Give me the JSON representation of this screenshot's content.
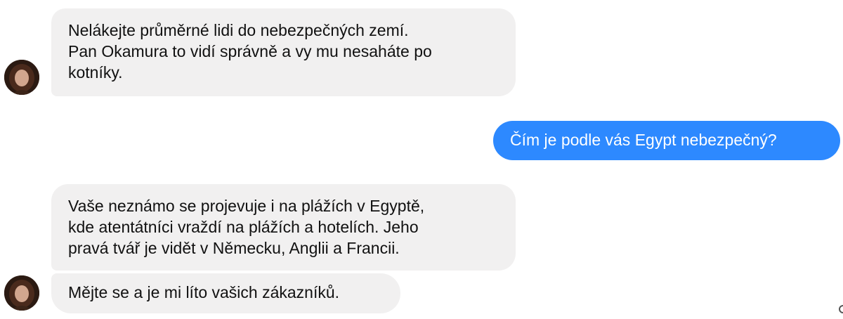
{
  "messages": [
    {
      "direction": "incoming",
      "lines": [
        "Nelákejte průměrné lidi do nebezpečných zemí.",
        "Pan Okamura to vidí správně a vy mu nesaháte po",
        "kotníky."
      ]
    },
    {
      "direction": "outgoing",
      "lines": [
        "Čím je podle vás Egypt nebezpečný?"
      ]
    },
    {
      "direction": "incoming",
      "lines": [
        "Vaše neznámo se projevuje i na plážích v Egyptě,",
        "kde atentátníci vraždí na plážích a hotelích. Jeho",
        "pravá tvář je vidět v Německu, Anglii a Francii."
      ]
    },
    {
      "direction": "incoming",
      "lines": [
        "Mějte se a je mi líto vašich zákazníků."
      ]
    }
  ],
  "colors": {
    "incoming_bubble": "#f1f0f0",
    "outgoing_bubble": "#2d89ff"
  },
  "icons": {
    "avatar": "user-avatar-photo",
    "edge": "seen-indicator-icon"
  }
}
